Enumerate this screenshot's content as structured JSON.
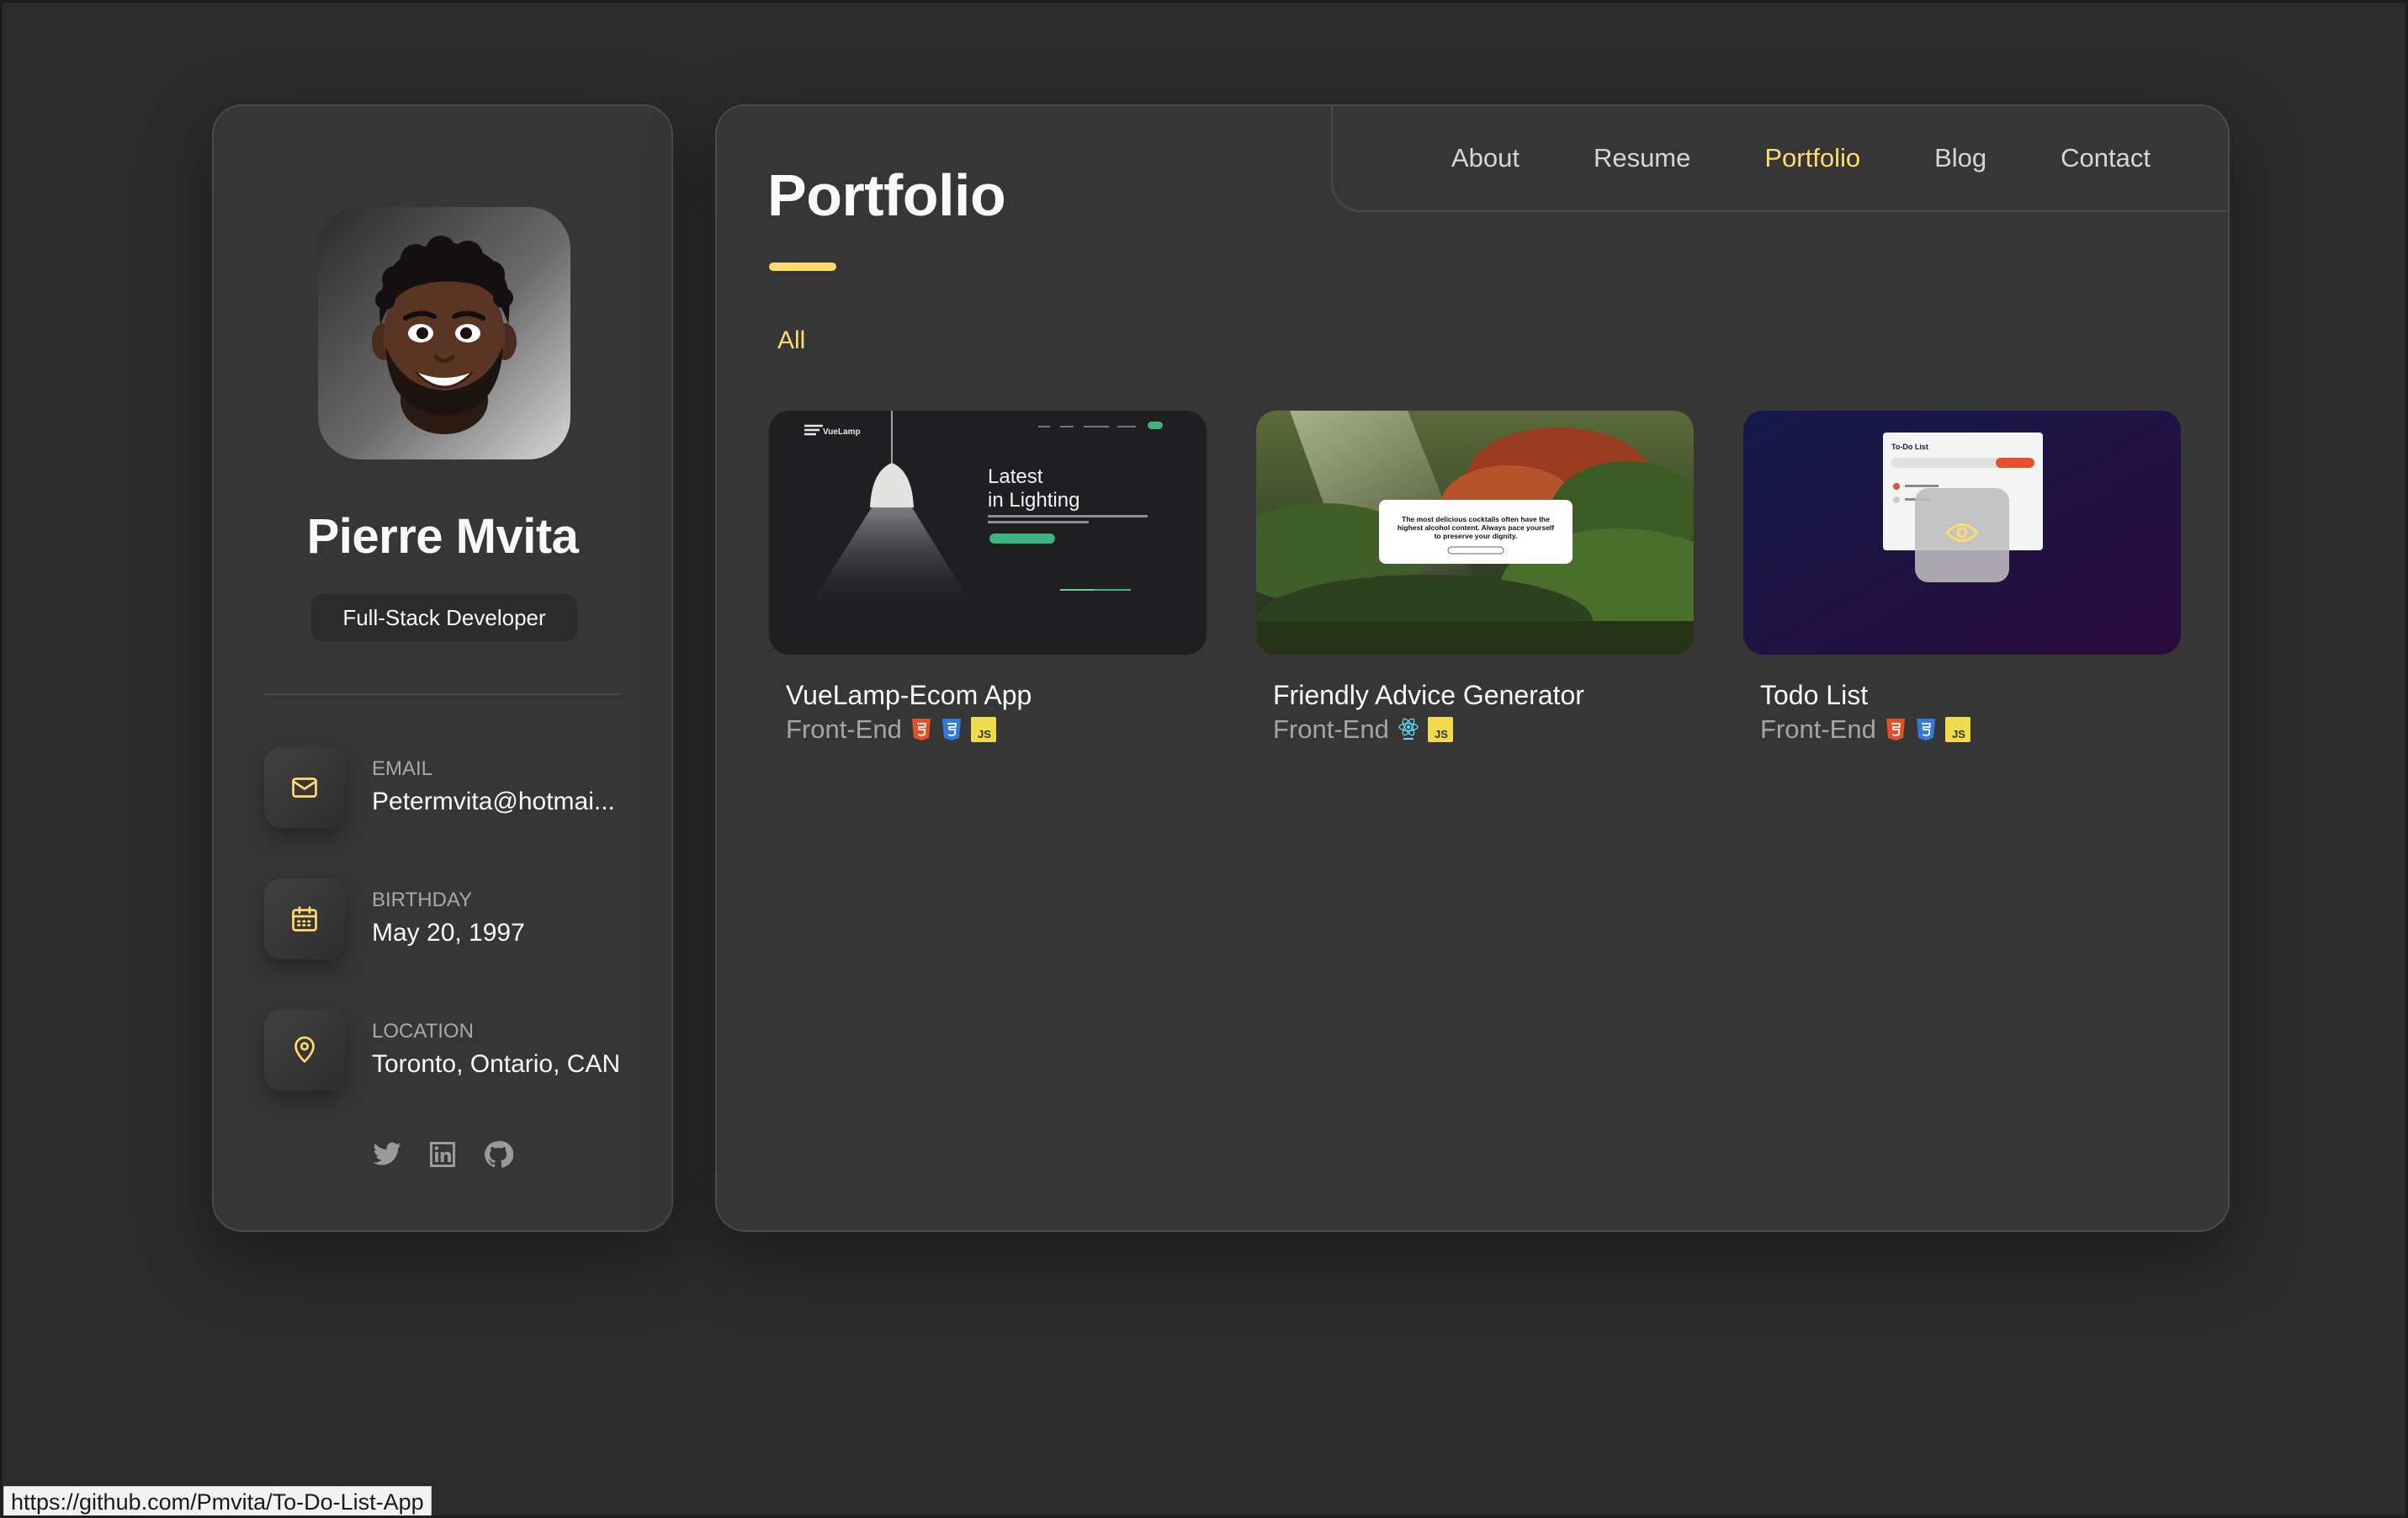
{
  "profile": {
    "name": "Pierre Mvita",
    "title": "Full-Stack Developer",
    "avatar_icon": "memoji-avatar"
  },
  "contacts": [
    {
      "label": "EMAIL",
      "value": "Petermvita@hotmai...",
      "icon": "mail-icon"
    },
    {
      "label": "BIRTHDAY",
      "value": "May 20, 1997",
      "icon": "calendar-icon"
    },
    {
      "label": "LOCATION",
      "value": "Toronto, Ontario, CAN",
      "icon": "location-pin-icon"
    }
  ],
  "socials": [
    "twitter-icon",
    "linkedin-icon",
    "github-icon"
  ],
  "nav": {
    "items": [
      "About",
      "Resume",
      "Portfolio",
      "Blog",
      "Contact"
    ],
    "active": "Portfolio"
  },
  "page": {
    "title": "Portfolio",
    "filter": "All"
  },
  "projects": [
    {
      "title": "VueLamp-Ecom App",
      "category": "Front-End",
      "tech": [
        "html5-icon",
        "css3-icon",
        "js-icon"
      ],
      "thumb_text": {
        "brand": "VueLamp",
        "headline_1": "Latest",
        "headline_2": "in Lighting"
      }
    },
    {
      "title": "Friendly Advice Generator",
      "category": "Front-End",
      "tech": [
        "react-icon",
        "js-icon"
      ],
      "thumb_text": {
        "quote": "The most delicious cocktails often have the highest alcohol content. Always pace yourself to preserve your dignity."
      }
    },
    {
      "title": "Todo List",
      "category": "Front-End",
      "tech": [
        "html5-icon",
        "css3-icon",
        "js-icon"
      ],
      "thumb_text": {
        "app_title": "To-Do List"
      }
    }
  ],
  "colors": {
    "accent": "#ffdb70",
    "panel": "#363637",
    "background": "#2b2b2c"
  },
  "status_url": "https://github.com/Pmvita/To-Do-List-App"
}
